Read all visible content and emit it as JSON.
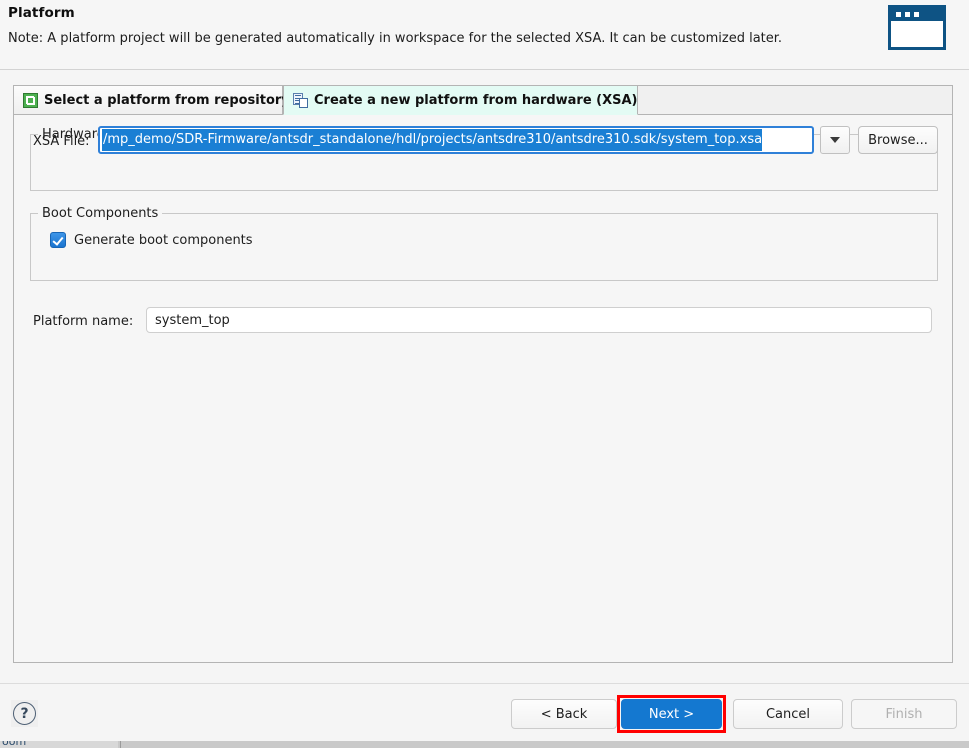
{
  "header": {
    "title": "Platform",
    "note": "Note: A platform project will be generated automatically in workspace for the selected XSA. It can be customized later.",
    "icon_name": "wizard-window-icon"
  },
  "tabs": [
    {
      "id": "select-from-repository",
      "label": "Select a platform from repository",
      "icon": "repository-icon",
      "active": false
    },
    {
      "id": "create-from-hardware",
      "label": "Create a new platform from hardware (XSA)",
      "icon": "xsa-file-icon",
      "active": true
    }
  ],
  "hardware_specification": {
    "legend": "Hardware Specification",
    "xsa_file_label": "XSA File:",
    "xsa_file_value": "/mp_demo/SDR-Firmware/antsdr_standalone/hdl/projects/antsdre310/antsdre310.sdk/system_top.xsa",
    "xsa_file_selected": true,
    "dropdown_icon": "chevron-down-icon",
    "browse_label": "Browse..."
  },
  "boot_components": {
    "legend": "Boot Components",
    "checkbox_label": "Generate boot components",
    "checked": true
  },
  "platform_name": {
    "label": "Platform name:",
    "value": "system_top",
    "placeholder": ""
  },
  "footer": {
    "help_glyph": "?",
    "back_label": "< Back",
    "next_label": "Next >",
    "cancel_label": "Cancel",
    "finish_label": "Finish",
    "finish_enabled": false,
    "next_highlighted": true
  },
  "bottom_strip": {
    "ghost_text": "oom"
  },
  "colors": {
    "accent_blue": "#1478d0",
    "selection_blue": "#1a7fd4",
    "focus_border": "#2f80d8",
    "highlight_red": "#ff0000",
    "active_tab_bg": "#e3fbf4",
    "icon_dark_blue": "#0e5384",
    "repo_icon_green": "#4cb04f",
    "panel_bg": "#f6f6f6"
  }
}
